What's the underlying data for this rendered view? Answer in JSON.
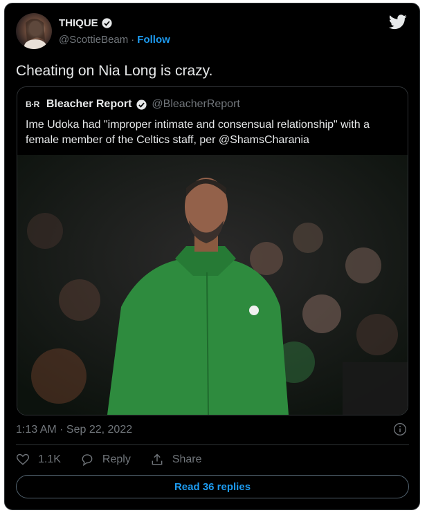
{
  "tweet": {
    "author": {
      "display_name": "THIQUE",
      "handle": "@ScottieBeam",
      "separator": "·",
      "follow_label": "Follow"
    },
    "text": "Cheating on Nia Long is crazy.",
    "timestamp": "1:13 AM · Sep 22, 2022",
    "actions": {
      "likes": "1.1K",
      "reply_label": "Reply",
      "share_label": "Share"
    },
    "read_replies_label": "Read 36 replies"
  },
  "quoted_tweet": {
    "logo_text": "B·R",
    "display_name": "Bleacher Report",
    "handle": "@BleacherReport",
    "text": "Ime Udoka had \"improper intimate and consensual relationship\" with a female member of the Celtics staff, per @ShamsCharania"
  },
  "colors": {
    "background": "#000000",
    "accent": "#1d9bf0",
    "muted": "#71767b",
    "jersey_green": "#2e8b3e"
  },
  "icons": [
    "twitter-bird-icon",
    "verified-badge-icon",
    "info-icon",
    "heart-icon",
    "reply-icon",
    "share-icon"
  ]
}
